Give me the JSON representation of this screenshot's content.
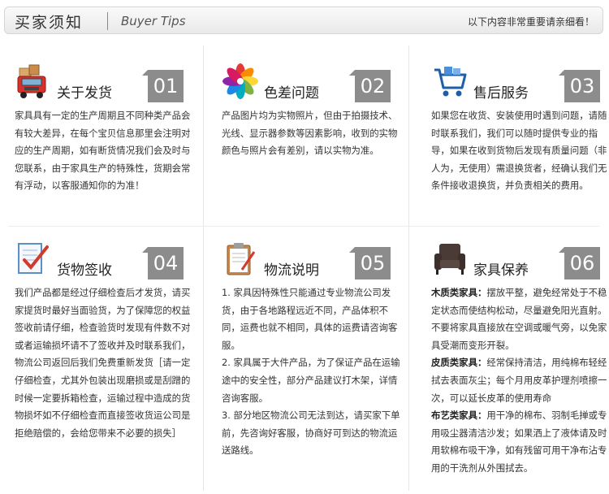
{
  "header": {
    "title_cn": "买家须知",
    "title_en": "Buyer Tips",
    "note": "以下内容非常重要请亲细看！"
  },
  "cards": [
    {
      "number": "01",
      "title": "关于发货",
      "icon": "delivery-truck-icon",
      "text": "家具具有一定的生产周期且不同种类产品会有较大差异，在每个宝贝信息那里会注明对应的生产周期，如有断货情况我们会及时与您联系，由于家具生产的特殊性，货期会常有浮动，以客服通知你的为准！"
    },
    {
      "number": "02",
      "title": "色差问题",
      "icon": "color-wheel-icon",
      "text": "产品图片均为实物照片，但由于拍摄技术、光线、显示器参数等因素影响，收到的实物颜色与照片会有差别，请以实物为准。"
    },
    {
      "number": "03",
      "title": "售后服务",
      "icon": "shopping-cart-icon",
      "text": "如果您在收货、安装使用时遇到问题，请随时联系我们，我们可以随时提供专业的指导，如果在收到货物后发现有质量问题（非人为，无使用）需退换货者，经确认我们无条件接收退换货，并负责相关的费用。"
    },
    {
      "number": "04",
      "title": "货物签收",
      "icon": "checklist-icon",
      "text": "我们产品都是经过仔细检查后才发货，请买家提货时最好当面验货，为了保障您的权益签收前请仔细，检查验货时发现有件数不对或者运输损坏请不了签收并及时联系我们，物流公司返回后我们免费重新发货［请一定仔细检查，尤其外包装出现磨损或是刮蹭的时候一定要拆箱检查，运输过程中造成的货物损坏如不仔细检查而直接签收货运公司是拒绝赔偿的，会给您带来不必要的损失］"
    },
    {
      "number": "05",
      "title": "物流说明",
      "icon": "clipboard-icon",
      "paragraphs": [
        "1. 家具因特殊性只能通过专业物流公司发货，由于各地路程远近不同，产品体积不同，运费也就不相同，具体的运费请咨询客服。",
        "2. 家具属于大件产品，为了保证产品在运输途中的安全性，部分产品建议打木架，详情咨询客服。",
        "3. 部分地区物流公司无法到达，请买家下单前，先咨询好客服，协商好可到达的物流运送路线。"
      ]
    },
    {
      "number": "06",
      "title": "家具保养",
      "icon": "armchair-icon",
      "items": [
        {
          "label": "木质类家具：",
          "text": "摆放平整，避免经常处于不稳定状态而使结构松动，尽量避免阳光直射。不要将家具直接放在空调或暖气旁，以免家具受潮而变形开裂。"
        },
        {
          "label": "皮质类家具：",
          "text": "经常保持清洁，用纯棉布轻经拭去表面灰尘；每个月用皮革护理剂喷擦一次，可以延长皮革的使用寿命"
        },
        {
          "label": "布艺类家具：",
          "text": "用干净的棉布、羽制毛掸或专用吸尘器清洁沙发；如果洒上了液体请及时用软棉布吸干净，如有残留可用干净布沾专用的干洗剂从外围拭去。"
        }
      ]
    }
  ]
}
